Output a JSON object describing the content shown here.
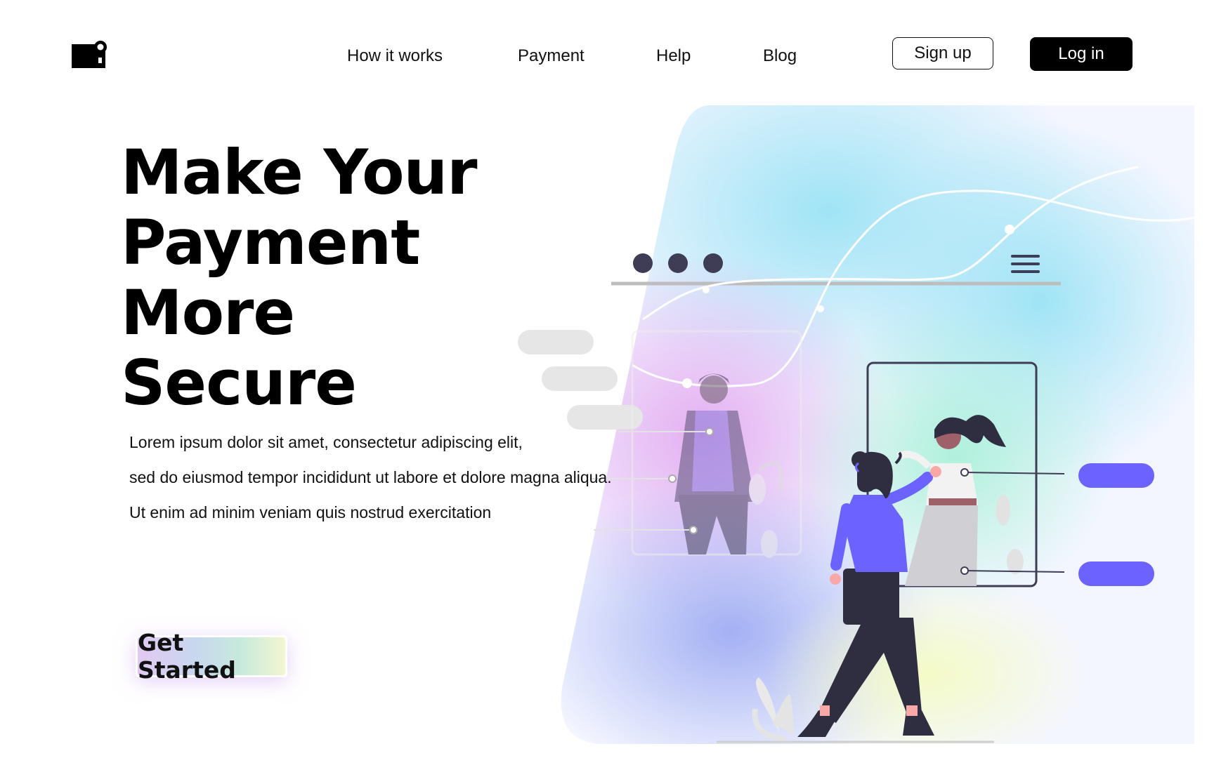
{
  "header": {
    "logo_icon": "camera-card-logo",
    "nav": [
      {
        "label": "How it works"
      },
      {
        "label": "Payment"
      },
      {
        "label": "Help"
      },
      {
        "label": "Blog"
      }
    ],
    "signup_label": "Sign up",
    "login_label": "Log in"
  },
  "hero": {
    "title_lines": [
      "Make Your",
      "Payment More",
      "Secure"
    ],
    "description_lines": [
      "Lorem ipsum dolor sit amet, consectetur adipiscing elit,",
      "sed do eiusmod tempor incididunt ut labore et dolore magna aliqua.",
      "Ut enim ad minim veniam  quis nostrud exercitation"
    ],
    "cta_label": "Get Started"
  },
  "colors": {
    "accent": "#6c63ff",
    "dark": "#2f2e41",
    "text": "#000000",
    "cta_gradient": [
      "#e3c9f2",
      "#c7d8ee",
      "#c7eadc",
      "#f3f6d2"
    ]
  }
}
